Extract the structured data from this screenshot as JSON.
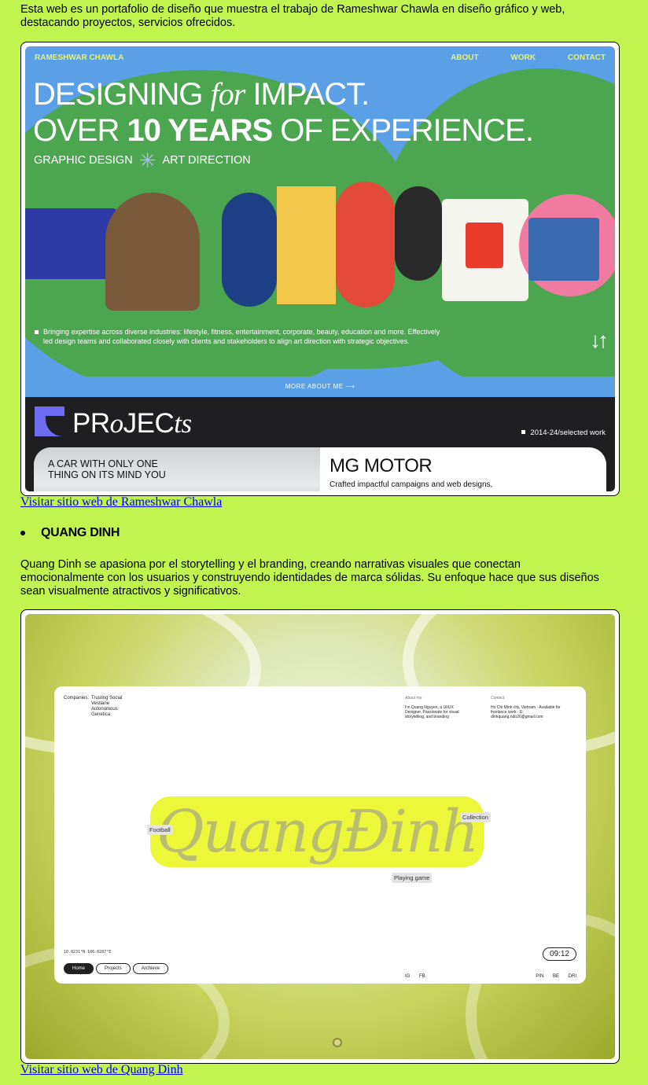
{
  "intro": "Esta web es un portafolio de diseño que muestra el trabajo de Rameshwar Chawla en diseño gráfico y web, destacando proyectos, servicios ofrecidos.",
  "rameshwar": {
    "brand": "RAMESHWAR CHAWLA",
    "nav": [
      "ABOUT",
      "WORK",
      "CONTACT"
    ],
    "headline1_a": "DESIGNING ",
    "headline1_b": "for",
    "headline1_c": " IMPACT.",
    "headline2_a": "OVER ",
    "headline2_b": "10 YEARS",
    "headline2_c": " OF EXPERIENCE.",
    "sub_a": "GRAPHIC DESIGN",
    "sub_star": "✳",
    "sub_b": "ART DIRECTION",
    "bullet": "Bringing expertise across diverse industries: lifestyle, fitness, entertainment, corporate, beauty, education and more. Effectively led design teams and collaborated closely with clients and stakeholders to align art direction with strategic objectives.",
    "arrows": "↓↑",
    "more": "MORE ABOUT ME ⟶",
    "projects_a": "PR",
    "projects_b": "o",
    "projects_c": "JEC",
    "projects_d": "ts",
    "projects_sel": "2014-24/selected work",
    "car_text": "A CAR WITH ONLY ONE THING ON ITS MIND YOU",
    "mg_title": "MG MOTOR",
    "mg_desc": "Crafted impactful campaigns and web designs,",
    "colors": {
      "sky": "#5b9fe6",
      "green": "#4ca54f",
      "accent": "#e8f26a",
      "dark": "#1f1f22"
    }
  },
  "link1": "Visitar sitio web de Rameshwar Chawla",
  "name2": "QUANG DINH",
  "desc2": "Quang Dinh se apasiona por el storytelling y el branding, creando narrativas visuales que conectan emocionalmente con los usuarios y construyendo identidades de marca sólidas. Su enfoque hace que sus diseños sean visualmente atractivos y significativos.",
  "quang": {
    "companies_label": "Companies:",
    "companies": [
      "Trusting Social",
      "Vestiane",
      "Autonomous",
      "Genetica"
    ],
    "about_h": "About me",
    "about": "I'm Quang Nguyen, a UI/UX Designer. Passionate for visual storytelling, and branding",
    "contact_h": "Contact",
    "contact": "Ho Chi Minh city, Vietnam · Available for freelance work · E: dinhquang.ndo26@gmail.com",
    "logo": "QuangĐinh",
    "tags": [
      "Football",
      "Collection",
      "Playing game"
    ],
    "coords": "10.0231°N 106.0287°E",
    "nav": [
      "Home",
      "Projects",
      "Archieve"
    ],
    "clock": "09:12",
    "social_left": [
      "IG",
      "FB"
    ],
    "social_right": [
      "PIN",
      "BE",
      "DRI"
    ]
  },
  "link2": "Visitar sitio web de Quang Dinh"
}
